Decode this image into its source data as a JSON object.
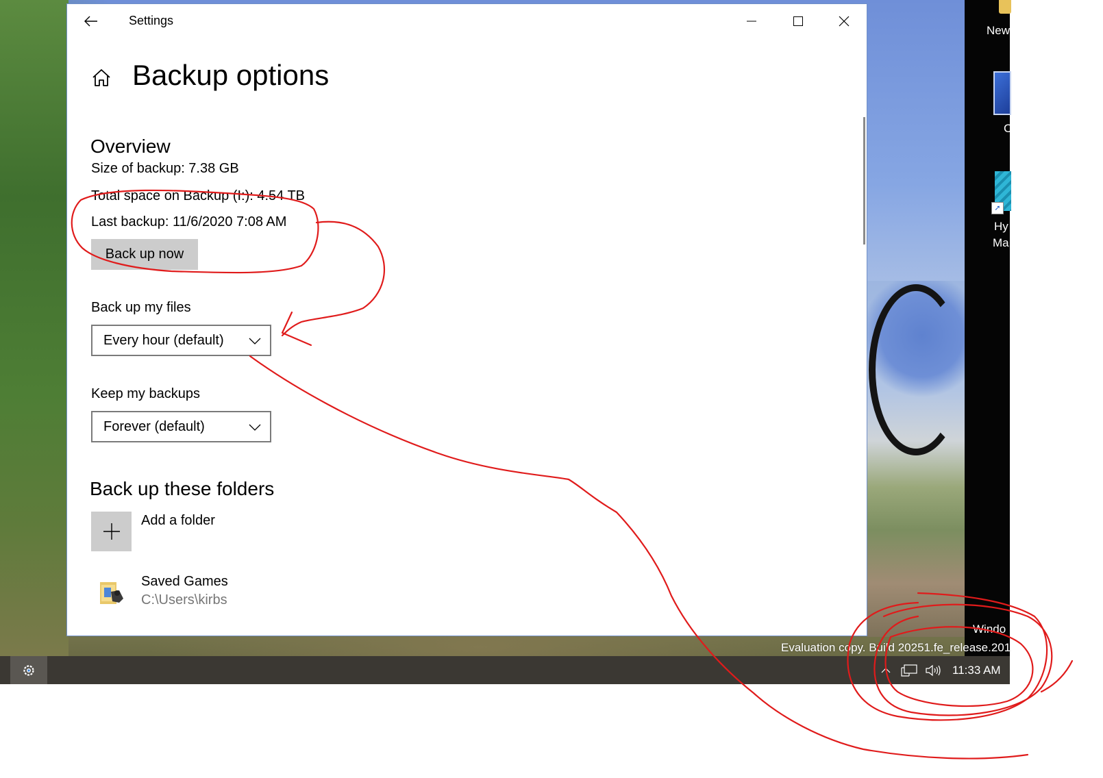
{
  "window": {
    "title": "Settings",
    "page_title": "Backup options",
    "controls": {
      "back_icon": "back-arrow-icon",
      "minimize_icon": "minimize-icon",
      "maximize_icon": "maximize-icon",
      "close_icon": "close-icon"
    }
  },
  "overview": {
    "heading": "Overview",
    "size_of_backup": "Size of backup: 7.38 GB",
    "total_space": "Total space on Backup (I:): 4.54 TB",
    "last_backup": "Last backup: 11/6/2020 7:08 AM",
    "back_up_now_label": "Back up now"
  },
  "schedule": {
    "frequency_label": "Back up my files",
    "frequency_value": "Every hour (default)",
    "retention_label": "Keep my backups",
    "retention_value": "Forever (default)"
  },
  "folders": {
    "heading": "Back up these folders",
    "add_folder_label": "Add a folder",
    "items": [
      {
        "name": "Saved Games",
        "path": "C:\\Users\\kirbs"
      }
    ]
  },
  "desktop": {
    "icon_labels": [
      "New",
      "C",
      "Hy",
      "Ma"
    ],
    "watermark_line1": "Windo",
    "watermark_line2": "Evaluation copy. Build 20251.fe_release.201"
  },
  "taskbar": {
    "clock": "11:33 AM",
    "tray_icons": [
      "show-hidden-chevron-icon",
      "network-icon",
      "volume-icon"
    ],
    "pinned_icons": [
      "settings-gear-icon"
    ]
  },
  "colors": {
    "annotation_red": "#e01b1b",
    "taskbar_bg": "#3b3833",
    "button_gray": "#cccccc",
    "path_gray": "#767676"
  }
}
